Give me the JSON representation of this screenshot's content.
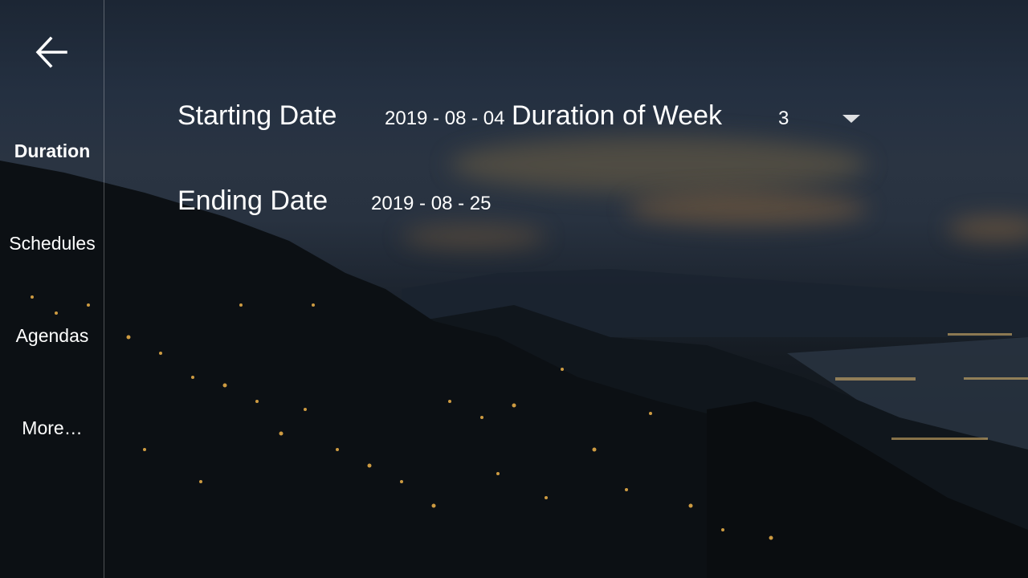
{
  "sidebar": {
    "back_label": "",
    "items": [
      {
        "label": "Duration",
        "active": true
      },
      {
        "label": "Schedules",
        "active": false
      },
      {
        "label": "Agendas",
        "active": false
      },
      {
        "label": "More…",
        "active": false
      }
    ]
  },
  "form": {
    "starting_date": {
      "label": "Starting Date",
      "value": "2019 - 08 - 04"
    },
    "ending_date": {
      "label": "Ending Date",
      "value": "2019 - 08 - 25"
    },
    "duration_of_week": {
      "label": "Duration of Week",
      "value": "3"
    }
  },
  "icons": {
    "back": "arrow-left-icon",
    "dropdown": "caret-down-icon"
  },
  "colors": {
    "text": "#ffffff",
    "divider": "#ffffff47",
    "background_sky": "#243041",
    "background_ground": "#0b0e11",
    "city_lights": "#f0b44a"
  }
}
